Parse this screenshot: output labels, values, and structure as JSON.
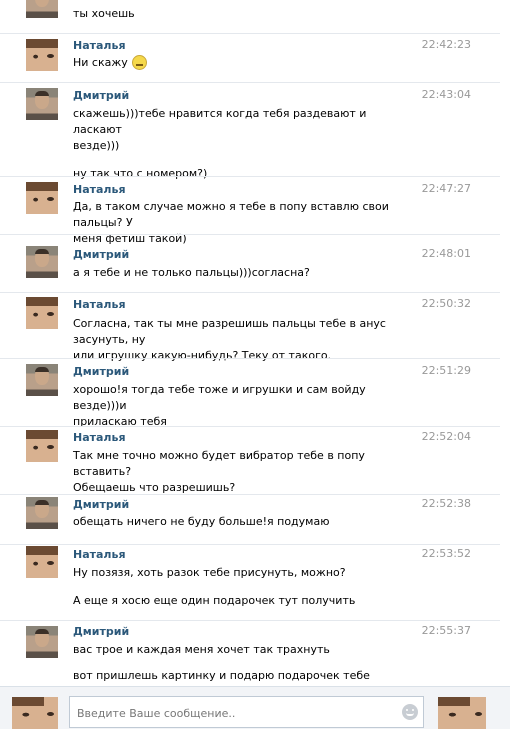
{
  "composer": {
    "placeholder": "Введите Ваше сообщение.."
  },
  "messages": [
    {
      "author": "",
      "time": "",
      "lines": [
        "ты хочешь"
      ],
      "avatar": "dmitry"
    },
    {
      "author": "Наталья",
      "time": "22:42:23",
      "lines": [
        "Ни скажу"
      ],
      "avatar": "natalya",
      "emoji": "smile-icon"
    },
    {
      "author": "Дмитрий",
      "time": "22:43:04",
      "lines": [
        "скажешь)))тебе нравится когда тебя раздевают и ласкают",
        "везде)))",
        "",
        "ну так что с номером?)"
      ],
      "avatar": "dmitry"
    },
    {
      "author": "Наталья",
      "time": "22:47:27",
      "lines": [
        "Да, в таком случае можно я тебе в попу вставлю свои пальцы? У",
        "меня фетиш такой)"
      ],
      "avatar": "natalya"
    },
    {
      "author": "Дмитрий",
      "time": "22:48:01",
      "lines": [
        "а я тебе и не только пальцы)))согласна?"
      ],
      "avatar": "dmitry"
    },
    {
      "author": "Наталья",
      "time": "22:50:32",
      "lines": [
        "Согласна, так ты мне разрешишь пальцы тебе в анус засунуть, ну",
        "или игрушку какую-нибудь? Теку от такого."
      ],
      "avatar": "natalya"
    },
    {
      "author": "Дмитрий",
      "time": "22:51:29",
      "lines": [
        "хорошо!я тогда тебе тоже и игрушки и сам войду везде)))и",
        "приласкаю тебя"
      ],
      "avatar": "dmitry"
    },
    {
      "author": "Наталья",
      "time": "22:52:04",
      "lines": [
        "Так мне точно можно будет вибратор тебе в попу вставить?",
        "Обещаешь что разрешишь?"
      ],
      "avatar": "natalya"
    },
    {
      "author": "Дмитрий",
      "time": "22:52:38",
      "lines": [
        "обещать ничего не буду больше!я подумаю"
      ],
      "avatar": "dmitry"
    },
    {
      "author": "Наталья",
      "time": "22:53:52",
      "lines": [
        "Ну позязя, хоть разок тебе присунуть, можно?",
        "",
        "А еще я хосю еще один подарочек тут получить"
      ],
      "avatar": "natalya"
    },
    {
      "author": "Дмитрий",
      "time": "22:55:37",
      "lines": [
        "вас трое и каждая меня хочет так трахнуть",
        "",
        "вот пришлешь картинку и подарю подарочек тебе"
      ],
      "avatar": "dmitry"
    }
  ]
}
